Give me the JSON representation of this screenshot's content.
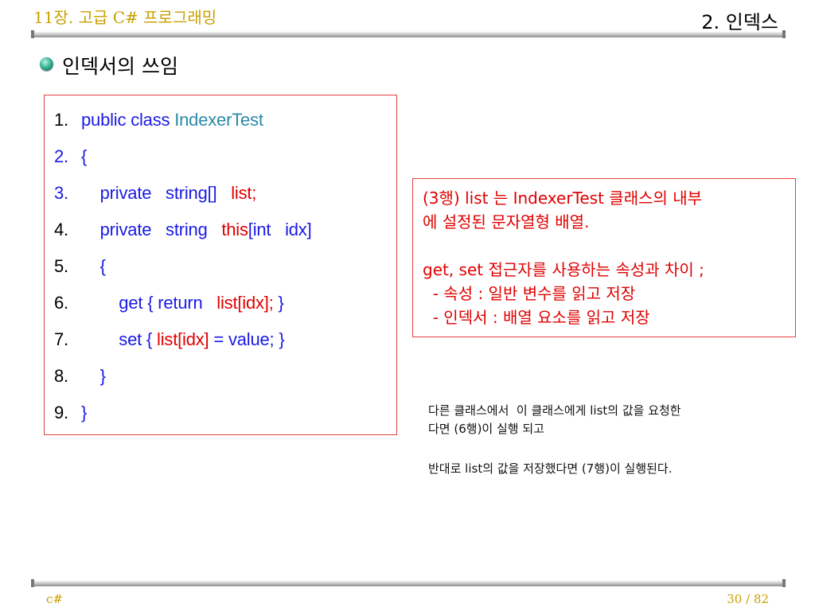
{
  "header": {
    "chapter_title": "11장. 고급 C# 프로그래밍",
    "section_title": "2. 인덱스"
  },
  "slide": {
    "heading": "인덱서의 쓰임",
    "bullet_icon": "green-sphere-bullet-icon"
  },
  "code": {
    "lines": [
      {
        "num": "1.",
        "segments": [
          {
            "text": "public class ",
            "color": "#1a1ae6"
          },
          {
            "text": "IndexerTest",
            "color": "#2a8aa8"
          }
        ]
      },
      {
        "num": "2.",
        "segments": [
          {
            "text": "{",
            "color": "#1a1ae6"
          }
        ]
      },
      {
        "num": "3.",
        "segments": [
          {
            "text": "    private   string[]   ",
            "color": "#1a1ae6"
          },
          {
            "text": "list;",
            "color": "#e00000"
          }
        ]
      },
      {
        "num": "4.",
        "segments": [
          {
            "text": "    private   string   ",
            "color": "#1a1ae6"
          },
          {
            "text": "this",
            "color": "#e00000"
          },
          {
            "text": "[int   idx]",
            "color": "#1a1ae6"
          }
        ]
      },
      {
        "num": "5.",
        "segments": [
          {
            "text": "    {",
            "color": "#1a1ae6"
          }
        ]
      },
      {
        "num": "6.",
        "segments": [
          {
            "text": "        get { return   ",
            "color": "#1a1ae6"
          },
          {
            "text": "list[idx];",
            "color": "#e00000"
          },
          {
            "text": " }",
            "color": "#1a1ae6"
          }
        ]
      },
      {
        "num": "7.",
        "segments": [
          {
            "text": "        set { ",
            "color": "#1a1ae6"
          },
          {
            "text": "list[idx]",
            "color": "#e00000"
          },
          {
            "text": " = value; }",
            "color": "#1a1ae6"
          }
        ]
      },
      {
        "num": "8.",
        "segments": [
          {
            "text": "    }",
            "color": "#1a1ae6"
          }
        ]
      },
      {
        "num": "9.",
        "segments": [
          {
            "text": "}",
            "color": "#1a1ae6"
          }
        ]
      }
    ]
  },
  "note": {
    "lines": [
      "(3행) list 는 IndexerTest 클래스의 내부",
      "에 설정된 문자열형 배열.",
      "",
      "get, set 접근자를 사용하는 속성과 차이 ;",
      "  - 속성 : 일반 변수를 읽고 저장",
      "  - 인덱서 : 배열 요소를 읽고 저장"
    ]
  },
  "explanation": {
    "line1": "다른 클래스에서  이 클래스에게 list의 값을 요청한",
    "line2": "다면 (6행)이 실행 되고",
    "line3": "반대로 list의 값을 저장했다면 (7행)이 실행된다."
  },
  "footer": {
    "left": "c#",
    "page": "30 / 82"
  },
  "colors": {
    "gold": "#c9a000",
    "code_blue": "#1a1ae6",
    "code_teal": "#2a8aa8",
    "code_red": "#e00000",
    "box_border": "#e04040"
  }
}
